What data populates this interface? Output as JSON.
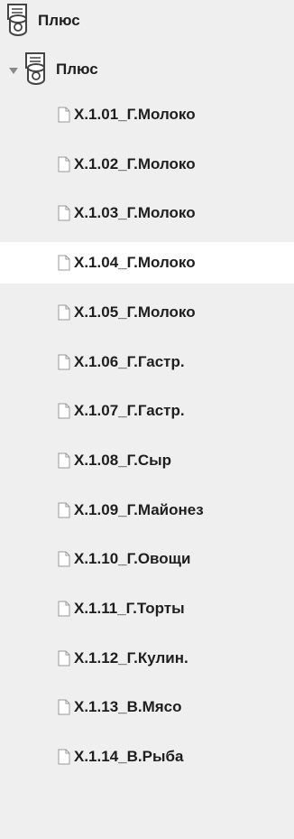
{
  "tree": {
    "root": {
      "label": "Плюс",
      "icon": "database-icon"
    },
    "child": {
      "label": "Плюс",
      "icon": "database-icon",
      "expanded": true
    },
    "selected_index": 3,
    "items": [
      {
        "label": "Х.1.01_Г.Молоко",
        "icon": "document-icon"
      },
      {
        "label": "Х.1.02_Г.Молоко",
        "icon": "document-icon"
      },
      {
        "label": "Х.1.03_Г.Молоко",
        "icon": "document-icon"
      },
      {
        "label": "Х.1.04_Г.Молоко",
        "icon": "document-icon"
      },
      {
        "label": "Х.1.05_Г.Молоко",
        "icon": "document-icon"
      },
      {
        "label": "Х.1.06_Г.Гастр.",
        "icon": "document-icon"
      },
      {
        "label": "Х.1.07_Г.Гастр.",
        "icon": "document-icon"
      },
      {
        "label": "Х.1.08_Г.Сыр",
        "icon": "document-icon"
      },
      {
        "label": "Х.1.09_Г.Майонез",
        "icon": "document-icon"
      },
      {
        "label": "Х.1.10_Г.Овощи",
        "icon": "document-icon"
      },
      {
        "label": "Х.1.11_Г.Торты",
        "icon": "document-icon"
      },
      {
        "label": "Х.1.12_Г.Кулин.",
        "icon": "document-icon"
      },
      {
        "label": "Х.1.13_В.Мясо",
        "icon": "document-icon"
      },
      {
        "label": "Х.1.14_В.Рыба",
        "icon": "document-icon"
      }
    ]
  },
  "colors": {
    "background": "#efefef",
    "selected_row": "#ffffff",
    "text": "#1e1e1e"
  }
}
